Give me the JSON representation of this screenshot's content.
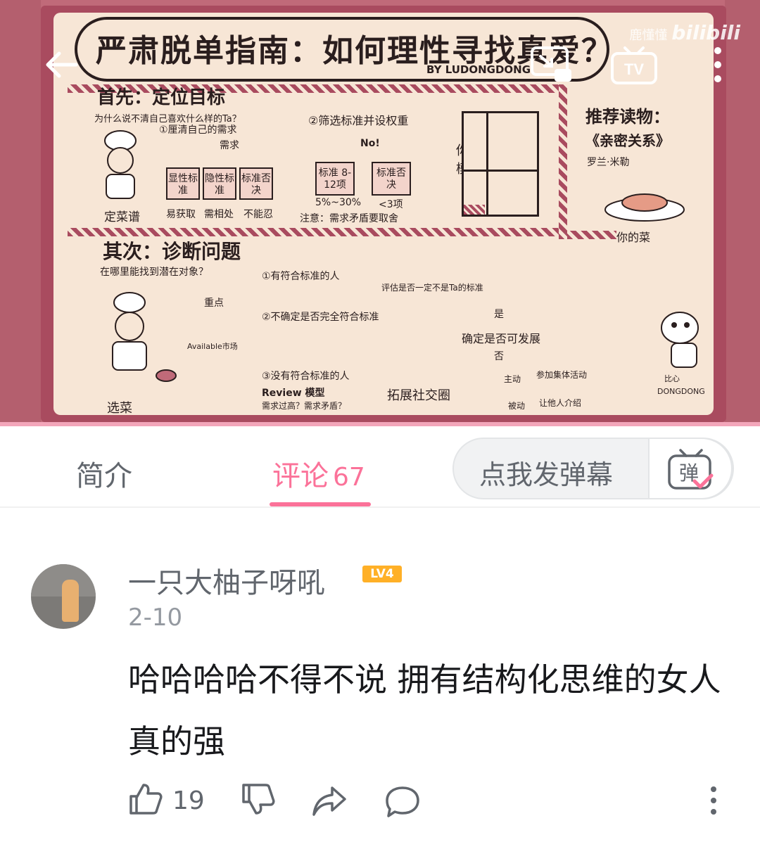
{
  "video": {
    "board_title": "严肃脱单指南：如何理性寻找真爱？",
    "board_byline": "BY LUDONGDONG",
    "watermark_user": "鹿懂懂",
    "watermark_brand": "bilibili",
    "sections": {
      "first_title": "首先：定位目标",
      "first_sub": "为什么说不清自己喜欢什么样的Ta？",
      "second_title": "其次：诊断问题",
      "second_sub": "在哪里能找到潜在对象？",
      "reading_title": "推荐读物：",
      "reading_book": "《亲密关系》",
      "reading_author": "罗兰·米勒"
    },
    "notes": {
      "sort_needs": "①厘清自己的需求",
      "needs": "需求",
      "box1": "显性标准",
      "box2": "隐性标准",
      "box3": "标准否决",
      "label1": "易获取",
      "label2": "需相处",
      "label3": "不能忍",
      "filter": "②筛选标准并设权重",
      "no": "No!",
      "box4": "标准 8-12项",
      "box5": "标准否决",
      "pct": "5%~30%",
      "lt3": "<3项",
      "caution": "注意：需求矛盾要取舍",
      "model": "你的模型",
      "recipe": "定菜谱",
      "focus": "重点",
      "available": "Available市场",
      "opt1": "①有符合标准的人",
      "opt2": "②不确定是否完全符合标准",
      "opt3": "③没有符合标准的人",
      "evaluate": "评估是否一定不是Ta的标准",
      "cook": "选菜",
      "review": "Review 模型",
      "review_q": "需求过高？需求矛盾？",
      "expand": "拓展社交圈",
      "confirm": "确定是否可发展",
      "yes": "是",
      "no2": "否",
      "active": "主动",
      "active_note": "参加集体活动",
      "passive": "被动",
      "passive_note": "让他人介绍",
      "your_dish": "你的菜",
      "dongdong": "DONGDONG",
      "bianxin": "比心"
    }
  },
  "tabs": {
    "intro_label": "简介",
    "comments_label": "评论",
    "comments_count": "67",
    "danmaku_placeholder": "点我发弹幕",
    "danmaku_button": "弹"
  },
  "comment": {
    "username": "一只大柚子呀吼",
    "level": "LV4",
    "date": "2-10",
    "content": "哈哈哈哈不得不说 拥有结构化思维的女人真的强",
    "like_count": "19"
  },
  "colors": {
    "accent": "#fb7299",
    "level_badge": "#ffb027",
    "board_frame": "#a94b5f",
    "board_paper": "#f7e6d6"
  },
  "icons": [
    "back-arrow-icon",
    "cast-icon",
    "tv-icon",
    "more-vert-icon",
    "danmaku-icon",
    "like-icon",
    "dislike-icon",
    "share-icon",
    "reply-icon",
    "more-dots-icon"
  ]
}
